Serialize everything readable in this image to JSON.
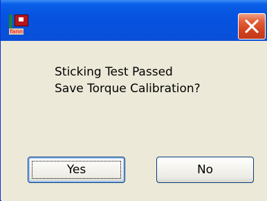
{
  "window": {
    "app_brand": "fann",
    "close_icon": "close-icon"
  },
  "message": {
    "line1": "Sticking Test Passed",
    "line2": "Save Torque Calibration?"
  },
  "buttons": {
    "yes_label": "Yes",
    "no_label": "No"
  },
  "colors": {
    "titlebar": "#0654e0",
    "close_button": "#d0401c",
    "dialog_background": "#ece9d8"
  }
}
